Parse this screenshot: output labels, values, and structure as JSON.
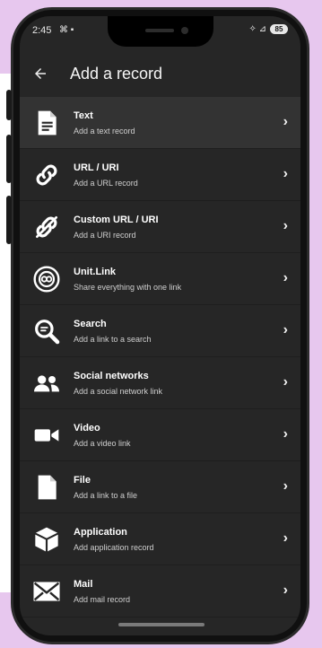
{
  "status": {
    "time": "2:45",
    "left_icons": "⌘ ▪",
    "right_icons": "✧ ⊿",
    "battery": "85"
  },
  "appbar": {
    "title": "Add a record",
    "back_icon": "arrow-left-icon"
  },
  "records": [
    {
      "id": "text",
      "title": "Text",
      "subtitle": "Add a text record",
      "icon": "document-icon"
    },
    {
      "id": "url",
      "title": "URL / URI",
      "subtitle": "Add a URL record",
      "icon": "link-icon"
    },
    {
      "id": "custom-url",
      "title": "Custom URL / URI",
      "subtitle": "Add a URI record",
      "icon": "custom-link-icon"
    },
    {
      "id": "unit-link",
      "title": "Unit.Link",
      "subtitle": "Share everything with one link",
      "icon": "unit-link-icon"
    },
    {
      "id": "search",
      "title": "Search",
      "subtitle": "Add a link to a search",
      "icon": "search-icon"
    },
    {
      "id": "social",
      "title": "Social networks",
      "subtitle": "Add a social network link",
      "icon": "people-icon"
    },
    {
      "id": "video",
      "title": "Video",
      "subtitle": "Add a video link",
      "icon": "video-camera-icon"
    },
    {
      "id": "file",
      "title": "File",
      "subtitle": "Add a link to a file",
      "icon": "file-icon"
    },
    {
      "id": "application",
      "title": "Application",
      "subtitle": "Add application record",
      "icon": "cube-icon"
    },
    {
      "id": "mail",
      "title": "Mail",
      "subtitle": "Add mail record",
      "icon": "envelope-icon"
    }
  ],
  "chevron": "›"
}
